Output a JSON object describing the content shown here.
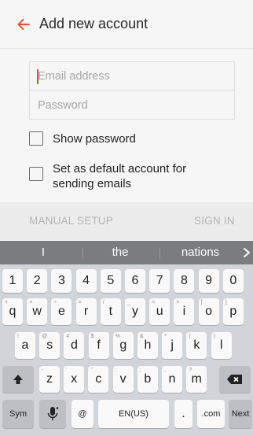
{
  "header": {
    "title": "Add new account"
  },
  "form": {
    "email_placeholder": "Email address",
    "password_placeholder": "Password",
    "show_password_label": "Show password",
    "default_account_label_line1": "Set as default account for",
    "default_account_label_line2": "sending emails"
  },
  "actions": {
    "manual_setup": "MANUAL SETUP",
    "sign_in": "SIGN IN"
  },
  "suggestions": [
    "I",
    "the",
    "nations"
  ],
  "keyboard": {
    "number_row": [
      "1",
      "2",
      "3",
      "4",
      "5",
      "6",
      "7",
      "8",
      "9",
      "0"
    ],
    "row1": [
      "q",
      "w",
      "e",
      "r",
      "t",
      "y",
      "u",
      "i",
      "o",
      "p"
    ],
    "row1_hints": [
      "+",
      "×",
      "÷",
      "=",
      "/",
      "_",
      "<",
      ">",
      "[",
      "]"
    ],
    "row2": [
      "a",
      "s",
      "d",
      "f",
      "g",
      "h",
      "j",
      "k",
      "l"
    ],
    "row2_hints": [
      "!",
      "@",
      "#",
      "$",
      "%",
      "&",
      "*",
      "(",
      ")"
    ],
    "row3": [
      "z",
      "x",
      "c",
      "v",
      "b",
      "n",
      "m"
    ],
    "row3_hints": [
      "-",
      "'",
      "\"",
      ":",
      ";",
      ",",
      "?"
    ],
    "sym": "Sym",
    "at": "@",
    "space": "EN(US)",
    "period": ".",
    "com": ".com",
    "next": "Next"
  },
  "colors": {
    "accent": "#e3523a",
    "suggestion_bar": "#7b7c7e",
    "keyboard_bg": "#d1d4d9"
  }
}
